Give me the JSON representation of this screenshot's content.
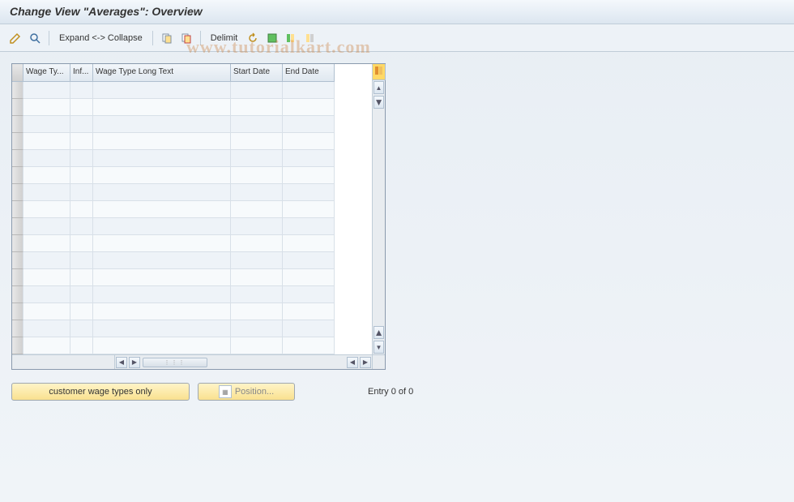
{
  "title": "Change View \"Averages\": Overview",
  "watermark": "www.tutorialkart.com",
  "toolbar": {
    "expand": "Expand <-> Collapse",
    "delimit": "Delimit"
  },
  "table": {
    "columns": {
      "sel": "",
      "wage_type": "Wage Ty...",
      "inf": "Inf...",
      "long_text": "Wage Type Long Text",
      "start_date": "Start Date",
      "end_date": "End Date"
    },
    "rows": [
      {
        "wage_type": "",
        "inf": "",
        "long_text": "",
        "start_date": "",
        "end_date": ""
      },
      {
        "wage_type": "",
        "inf": "",
        "long_text": "",
        "start_date": "",
        "end_date": ""
      },
      {
        "wage_type": "",
        "inf": "",
        "long_text": "",
        "start_date": "",
        "end_date": ""
      },
      {
        "wage_type": "",
        "inf": "",
        "long_text": "",
        "start_date": "",
        "end_date": ""
      },
      {
        "wage_type": "",
        "inf": "",
        "long_text": "",
        "start_date": "",
        "end_date": ""
      },
      {
        "wage_type": "",
        "inf": "",
        "long_text": "",
        "start_date": "",
        "end_date": ""
      },
      {
        "wage_type": "",
        "inf": "",
        "long_text": "",
        "start_date": "",
        "end_date": ""
      },
      {
        "wage_type": "",
        "inf": "",
        "long_text": "",
        "start_date": "",
        "end_date": ""
      },
      {
        "wage_type": "",
        "inf": "",
        "long_text": "",
        "start_date": "",
        "end_date": ""
      },
      {
        "wage_type": "",
        "inf": "",
        "long_text": "",
        "start_date": "",
        "end_date": ""
      },
      {
        "wage_type": "",
        "inf": "",
        "long_text": "",
        "start_date": "",
        "end_date": ""
      },
      {
        "wage_type": "",
        "inf": "",
        "long_text": "",
        "start_date": "",
        "end_date": ""
      },
      {
        "wage_type": "",
        "inf": "",
        "long_text": "",
        "start_date": "",
        "end_date": ""
      },
      {
        "wage_type": "",
        "inf": "",
        "long_text": "",
        "start_date": "",
        "end_date": ""
      },
      {
        "wage_type": "",
        "inf": "",
        "long_text": "",
        "start_date": "",
        "end_date": ""
      },
      {
        "wage_type": "",
        "inf": "",
        "long_text": "",
        "start_date": "",
        "end_date": ""
      }
    ]
  },
  "footer": {
    "customer_btn": "customer wage types only",
    "position_btn": "Position...",
    "entry_status": "Entry 0 of 0"
  }
}
